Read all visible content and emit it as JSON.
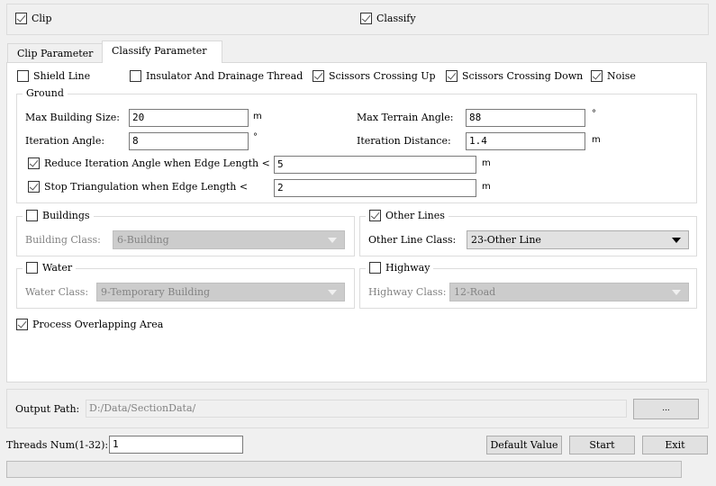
{
  "top": {
    "clip": {
      "label": "Clip",
      "checked": true
    },
    "classify": {
      "label": "Classify",
      "checked": true
    }
  },
  "tabs": [
    {
      "label": "Clip Parameter",
      "active": false
    },
    {
      "label": "Classify Parameter",
      "active": true
    }
  ],
  "classify": {
    "options": [
      {
        "label": "Shield Line",
        "checked": false
      },
      {
        "label": "Insulator And Drainage Thread",
        "checked": false
      },
      {
        "label": "Scissors Crossing Up",
        "checked": true
      },
      {
        "label": "Scissors Crossing Down",
        "checked": true
      },
      {
        "label": "Noise",
        "checked": true
      }
    ],
    "ground": {
      "title": "Ground",
      "max_building_size": {
        "label": "Max Building Size:",
        "value": "20",
        "unit": "m"
      },
      "max_terrain_angle": {
        "label": "Max Terrain Angle:",
        "value": "88",
        "unit": "°"
      },
      "iteration_angle": {
        "label": "Iteration Angle:",
        "value": "8",
        "unit": "°"
      },
      "iteration_distance": {
        "label": "Iteration Distance:",
        "value": "1.4",
        "unit": "m"
      },
      "reduce_iteration": {
        "label": "Reduce Iteration Angle when Edge Length <",
        "checked": true,
        "value": "5",
        "unit": "m"
      },
      "stop_triangulation": {
        "label": "Stop Triangulation when Edge Length <",
        "checked": true,
        "value": "2",
        "unit": "m"
      }
    },
    "buildings": {
      "title": "Buildings",
      "checked": false,
      "class_label": "Building Class:",
      "class_value": "6-Building"
    },
    "other_lines": {
      "title": "Other Lines",
      "checked": true,
      "class_label": "Other Line Class:",
      "class_value": "23-Other Line"
    },
    "water": {
      "title": "Water",
      "checked": false,
      "class_label": "Water Class:",
      "class_value": "9-Temporary Building"
    },
    "highway": {
      "title": "Highway",
      "checked": false,
      "class_label": "Highway Class:",
      "class_value": "12-Road"
    },
    "process_overlapping": {
      "label": "Process Overlapping Area",
      "checked": true
    }
  },
  "output": {
    "label": "Output Path:",
    "value": "D:/Data/SectionData/",
    "browse_label": "..."
  },
  "threads": {
    "label": "Threads Num(1-32):",
    "value": "1"
  },
  "buttons": {
    "default_value": "Default Value",
    "start": "Start",
    "exit": "Exit"
  },
  "progress": {
    "value": 0
  }
}
